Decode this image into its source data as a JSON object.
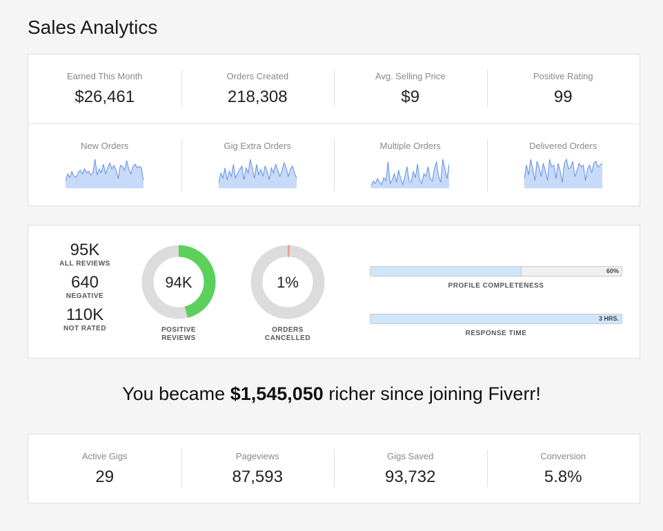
{
  "page": {
    "title": "Sales Analytics"
  },
  "top_stats": [
    {
      "label": "Earned This Month",
      "value": "$26,461"
    },
    {
      "label": "Orders Created",
      "value": "218,308"
    },
    {
      "label": "Avg. Selling Price",
      "value": "$9"
    },
    {
      "label": "Positive Rating",
      "value": "99"
    }
  ],
  "sparklines": [
    {
      "label": "New Orders",
      "values": [
        6,
        12,
        9,
        14,
        10,
        9,
        13,
        15,
        12,
        16,
        13,
        14,
        11,
        13,
        24,
        11,
        16,
        13,
        20,
        12,
        17,
        21,
        16,
        19,
        15,
        8,
        19,
        18,
        15,
        23,
        16,
        12,
        18,
        20,
        17,
        18,
        17,
        6
      ]
    },
    {
      "label": "Gig Extra Orders",
      "values": [
        6,
        18,
        12,
        24,
        10,
        20,
        14,
        28,
        12,
        18,
        22,
        26,
        10,
        24,
        18,
        34,
        22,
        12,
        28,
        16,
        22,
        14,
        26,
        20,
        10,
        24,
        18,
        28,
        22,
        14,
        20,
        30,
        24,
        14,
        22,
        26,
        18,
        12
      ]
    },
    {
      "label": "Multiple Orders",
      "values": [
        2,
        6,
        4,
        8,
        5,
        3,
        9,
        6,
        22,
        4,
        7,
        12,
        5,
        15,
        8,
        3,
        10,
        18,
        6,
        5,
        14,
        9,
        20,
        7,
        4,
        12,
        10,
        18,
        8,
        6,
        16,
        22,
        10,
        5,
        24,
        16,
        8,
        20
      ]
    },
    {
      "label": "Delivered Orders",
      "values": [
        10,
        24,
        14,
        30,
        20,
        8,
        28,
        22,
        12,
        26,
        18,
        8,
        30,
        22,
        24,
        10,
        26,
        18,
        6,
        26,
        30,
        20,
        22,
        28,
        12,
        18,
        26,
        22,
        24,
        8,
        20,
        24,
        16,
        26,
        28,
        22,
        24,
        26
      ]
    }
  ],
  "reviews": {
    "counts": [
      {
        "value": "95K",
        "label": "ALL REVIEWS"
      },
      {
        "value": "640",
        "label": "NEGATIVE"
      },
      {
        "value": "110K",
        "label": "NOT RATED"
      }
    ],
    "donuts": [
      {
        "value": "94K",
        "label_line1": "POSITIVE",
        "label_line2": "REVIEWS",
        "fraction": 0.46,
        "color": "#5bd05b"
      },
      {
        "value": "1%",
        "label_line1": "ORDERS",
        "label_line2": "CANCELLED",
        "fraction": 0.01,
        "color": "#f29a9a"
      }
    ],
    "progress": [
      {
        "text": "60%",
        "caption": "PROFILE COMPLETENESS",
        "fraction": 0.6
      },
      {
        "text": "3 HRS.",
        "caption": "RESPONSE TIME",
        "fraction": 1.0
      }
    ]
  },
  "banner": {
    "prefix": "You became ",
    "amount": "$1,545,050",
    "suffix": " richer since joining Fiverr!"
  },
  "bottom_stats": [
    {
      "label": "Active Gigs",
      "value": "29"
    },
    {
      "label": "Pageviews",
      "value": "87,593"
    },
    {
      "label": "Gigs Saved",
      "value": "93,732"
    },
    {
      "label": "Conversion",
      "value": "5.8%"
    }
  ],
  "colors": {
    "spark_fill": "#c7dafa",
    "spark_line": "#5f8fe0",
    "donut_track": "#dcdcdc"
  }
}
